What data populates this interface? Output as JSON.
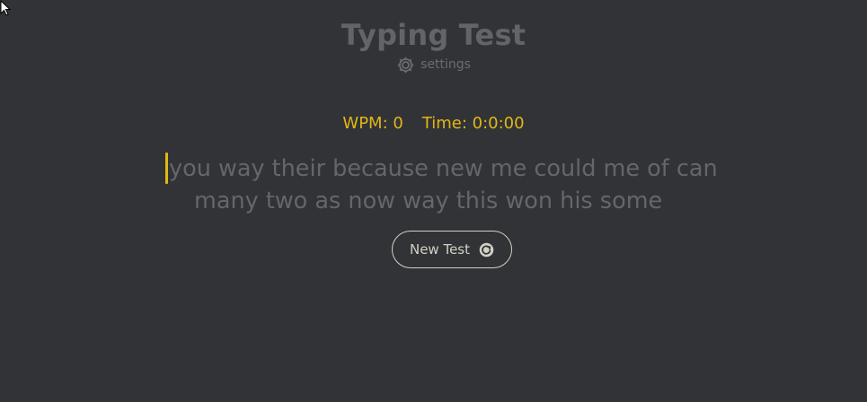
{
  "header": {
    "title": "Typing Test",
    "settings_label": "settings"
  },
  "stats": {
    "wpm": "WPM: 0",
    "time": "Time: 0:0:00"
  },
  "test": {
    "lines": [
      "you way their because new me could me of can",
      "many two as now way this won his some"
    ]
  },
  "actions": {
    "new_test_label": "New Test"
  },
  "colors": {
    "background": "#323337",
    "accent": "#e2b714",
    "title": "#636468",
    "words": "#646669",
    "button": "#d1d0c5"
  },
  "icons": {
    "settings": "gear-icon",
    "new_test": "refresh-icon",
    "pointer": "mouse-cursor-icon"
  }
}
